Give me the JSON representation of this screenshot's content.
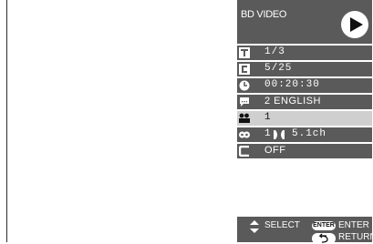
{
  "osd": {
    "title": "BD VIDEO",
    "rows": [
      {
        "icon": "title-icon",
        "value": "1/3"
      },
      {
        "icon": "chapter-icon",
        "value": "5/25"
      },
      {
        "icon": "clock-icon",
        "value": "00:20:30"
      },
      {
        "icon": "subtitle-icon",
        "value": "2 ENGLISH"
      },
      {
        "icon": "angle-icon",
        "value": "1"
      },
      {
        "icon": "audio-icon",
        "value": "1",
        "codec_value": "5.1ch"
      },
      {
        "icon": "subtitle-style-icon",
        "value": "OFF"
      }
    ],
    "selected_row": 4
  },
  "footer": {
    "select_label": "SELECT",
    "enter_button": "ENTER",
    "enter_label": "ENTER",
    "return_label": "RETURN"
  },
  "colors": {
    "panel": "#5a5a5a",
    "selected": "#cfcfcf",
    "text": "#ffffff",
    "background": "#ffffff"
  }
}
